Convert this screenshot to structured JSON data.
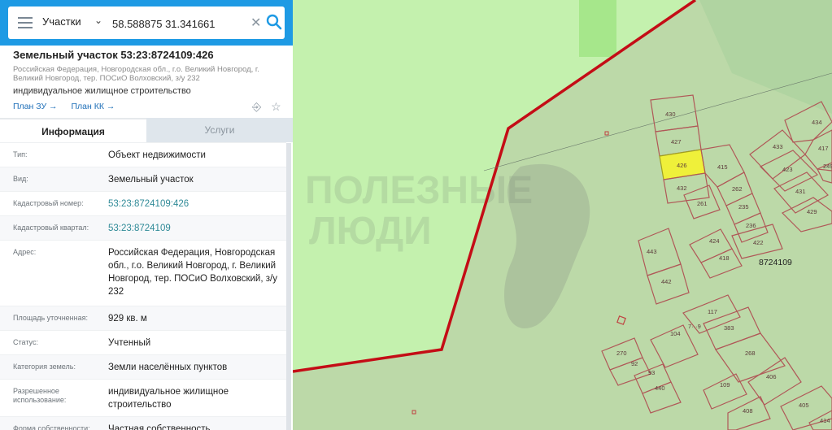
{
  "search": {
    "type_label": "Участки",
    "value": "58.588875 31.341661"
  },
  "parcel": {
    "title": "Земельный участок 53:23:8724109:426",
    "address_short": "Российская Федерация, Новгородская обл., г.о. Великий Новгород, г. Великий Новгород, тер. ПОСиО Волховский, з/у 232",
    "use": "индивидуальное жилищное строительство",
    "links": [
      "План ЗУ →",
      "План КК →"
    ]
  },
  "tabs": [
    "Информация",
    "Услуги"
  ],
  "info_rows": [
    {
      "key": "Тип:",
      "value": "Объект недвижимости",
      "link": false
    },
    {
      "key": "Вид:",
      "value": "Земельный участок",
      "link": false
    },
    {
      "key": "Кадастровый номер:",
      "value": "53:23:8724109:426",
      "link": true
    },
    {
      "key": "Кадастровый квартал:",
      "value": "53:23:8724109",
      "link": true
    },
    {
      "key": "Адрес:",
      "value": "Российская Федерация, Новгородская обл., г.о. Великий Новгород, г. Великий Новгород, тер. ПОСиО Волховский, з/у 232",
      "link": false
    },
    {
      "key": "Площадь уточненная:",
      "value": "929 кв. м",
      "link": false
    },
    {
      "key": "Статус:",
      "value": "Учтенный",
      "link": false
    },
    {
      "key": "Категория земель:",
      "value": "Земли населённых пунктов",
      "link": false
    },
    {
      "key": "Разрешенное использование:",
      "value": "индивидуальное жилищное строительство",
      "link": false
    },
    {
      "key": "Форма собственности:",
      "value": "Частная собственность",
      "link": false
    }
  ],
  "map": {
    "block_label": "8724109",
    "watermark": [
      "ПОЛЕЗНЫЕ",
      "ЛЮДИ"
    ],
    "parcels": [
      "430",
      "427",
      "426",
      "432",
      "415",
      "261",
      "262",
      "235",
      "236",
      "434",
      "433",
      "417",
      "423",
      "249",
      "431",
      "429",
      "424",
      "422",
      "418",
      "443",
      "442",
      "117",
      "104",
      "383",
      "7···9",
      "268",
      "270",
      "92",
      "93",
      "440",
      "109",
      "406",
      "408",
      "405",
      "414"
    ],
    "colors": {
      "map_green": "#c3f0ad",
      "map_bg": "#b9d8a6",
      "boundary": "#c40d16",
      "parcel_line": "#b56060",
      "selected": "#eff03a"
    }
  },
  "colors": {
    "accent": "#1e9ae4"
  }
}
